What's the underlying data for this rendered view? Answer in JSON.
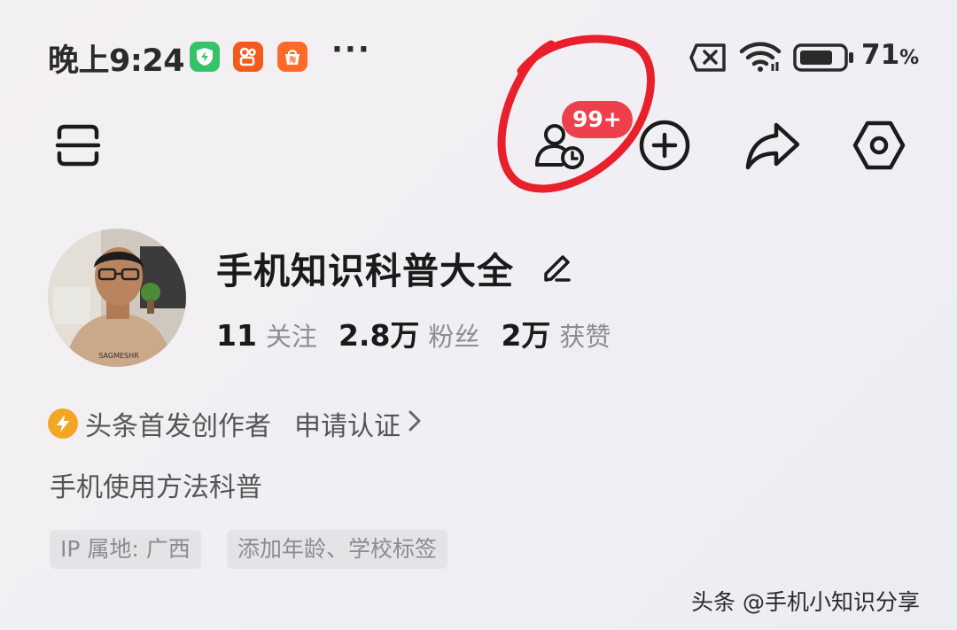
{
  "status_bar": {
    "time": "晚上9:24",
    "app_icons": [
      "shield-app-icon",
      "kuaishou-icon",
      "taobao-icon"
    ],
    "more": "···",
    "battery_percent": "71",
    "battery_unit": "%"
  },
  "toolbar": {
    "visitors_badge": "99+",
    "icons": [
      "scan-icon",
      "visitors-icon",
      "add-icon",
      "share-icon",
      "settings-icon"
    ]
  },
  "profile": {
    "username": "手机知识科普大全",
    "stats": [
      {
        "value": "11",
        "label": "关注"
      },
      {
        "value": "2.8万",
        "label": "粉丝"
      },
      {
        "value": "2万",
        "label": "获赞"
      }
    ],
    "creator_label": "头条首发创作者",
    "apply_label": "申请认证",
    "bio": "手机使用方法科普",
    "tags": [
      "IP 属地: 广西",
      "添加年龄、学校标签"
    ],
    "avatar_shirt_text": "SAGMESHR"
  },
  "watermark": "头条 @手机小知识分享",
  "colors": {
    "badge": "#ee3f4d",
    "annotation_circle": "#e8202c",
    "creator_bolt": "#f3a622",
    "label_gray": "#8d8d91"
  }
}
